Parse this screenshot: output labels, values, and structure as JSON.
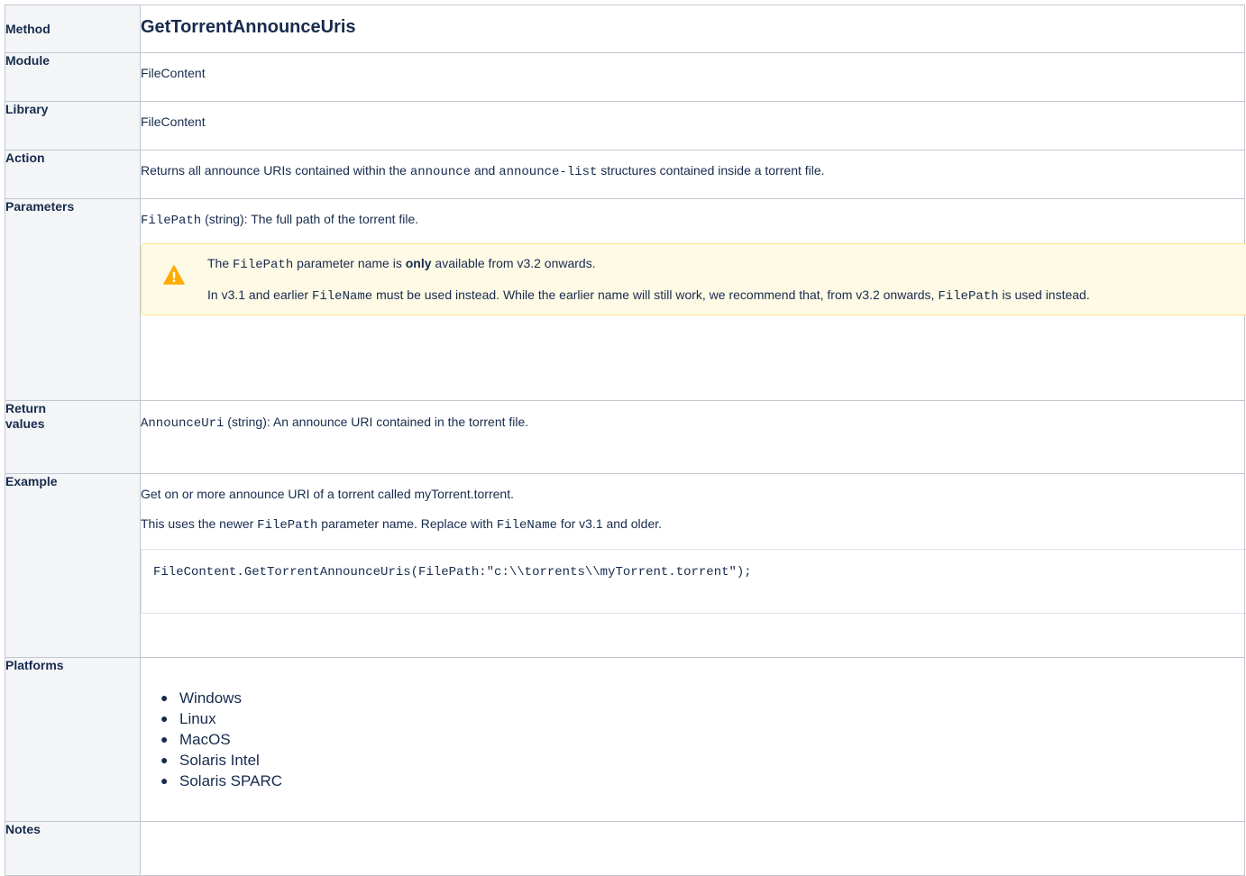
{
  "rows": {
    "method": {
      "label": "Method",
      "value": "GetTorrentAnnounceUris"
    },
    "module": {
      "label": "Module",
      "value": "FileContent"
    },
    "library": {
      "label": "Library",
      "value": "FileContent"
    },
    "action": {
      "label": "Action",
      "text1": "Returns all announce URIs contained within the ",
      "code1": "announce",
      "text2": " and ",
      "code2": "announce-list",
      "text3": " structures contained inside a torrent file."
    },
    "parameters": {
      "label": "Parameters",
      "param_code": "FilePath",
      "param_text": " (string): The full path of the torrent file.",
      "warning": {
        "icon": "warning-icon",
        "line1_text1": "The ",
        "line1_code": "FilePath",
        "line1_text2": " parameter name is ",
        "line1_bold": "only",
        "line1_text3": " available from v3.2 onwards.",
        "line2_text1": "In v3.1 and earlier ",
        "line2_code1": "FileName",
        "line2_text2": " must be used instead.  While the earlier name will still work, we recommend that, from v3.2 onwards, ",
        "line2_code2": "FilePath",
        "line2_text3": " is used instead."
      }
    },
    "return_values": {
      "label_line1": "Return",
      "label_line2": "values",
      "code": "AnnounceUri",
      "text": " (string): An announce URI contained in the torrent file."
    },
    "example": {
      "label": "Example",
      "line1": "Get on or more announce URI of a torrent called myTorrent.torrent.",
      "line2_text1": "This uses the newer ",
      "line2_code1": "FilePath",
      "line2_text2": " parameter name. Replace with ",
      "line2_code2": "FileName",
      "line2_text3": " for v3.1 and older.",
      "code_block": "FileContent.GetTorrentAnnounceUris(FilePath:\"c:\\\\torrents\\\\myTorrent.torrent\");"
    },
    "platforms": {
      "label": "Platforms",
      "items": [
        "Windows",
        "Linux",
        "MacOS",
        "Solaris Intel",
        "Solaris SPARC"
      ]
    },
    "notes": {
      "label": "Notes"
    }
  },
  "colors": {
    "header_bg": "#f4f5f7",
    "border": "#c1c7d0",
    "warning_bg": "#fffae6",
    "warning_border": "#ffe380"
  }
}
